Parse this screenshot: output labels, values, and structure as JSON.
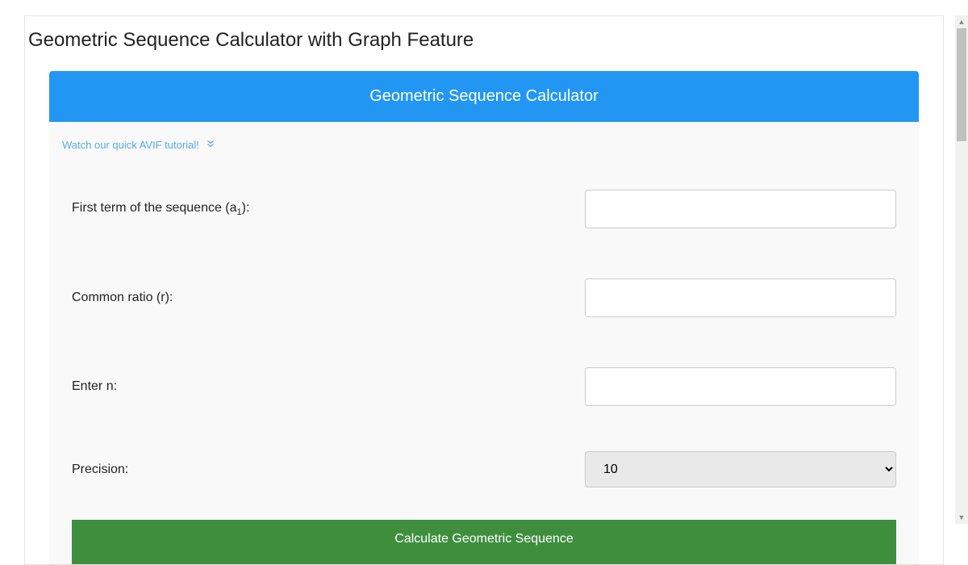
{
  "page": {
    "title": "Geometric Sequence Calculator with Graph Feature"
  },
  "card": {
    "header": "Geometric Sequence Calculator",
    "tutorial": {
      "text": "Watch our quick AVIF tutorial!",
      "icon": "chevron-double-down"
    }
  },
  "form": {
    "fields": [
      {
        "label_prefix": "First term of the sequence (a",
        "label_sub": "1",
        "label_suffix": "):",
        "value": "",
        "type": "text"
      },
      {
        "label": "Common ratio (r):",
        "value": "",
        "type": "text"
      },
      {
        "label": "Enter n:",
        "value": "",
        "type": "text"
      },
      {
        "label": "Precision:",
        "value": "10",
        "type": "select"
      }
    ],
    "button": "Calculate Geometric Sequence"
  }
}
